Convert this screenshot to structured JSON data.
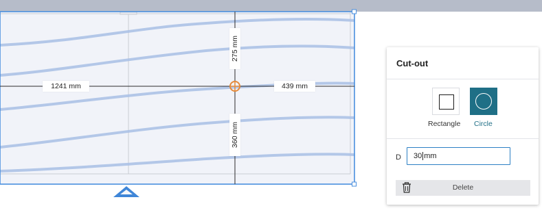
{
  "dimensions": {
    "left": "1241 mm",
    "right": "439 mm",
    "top": "275 mm",
    "bottom": "360 mm"
  },
  "panel": {
    "title": "Cut-out",
    "shapes": [
      {
        "label": "Rectangle",
        "icon": "square-outline-icon",
        "selected": false
      },
      {
        "label": "Circle",
        "icon": "circle-outline-icon",
        "selected": true
      }
    ],
    "diameter_label": "D",
    "diameter_value": "30",
    "diameter_unit": "mm",
    "delete_label": "Delete",
    "delete_icon": "trash-icon"
  },
  "colors": {
    "selection_blue": "#4a8fde",
    "marker_orange": "#e58a3a",
    "active_shape_bg": "#1f6f86",
    "top_bar": "#b6bcc9",
    "wave_blue": "#a9c0e6"
  }
}
